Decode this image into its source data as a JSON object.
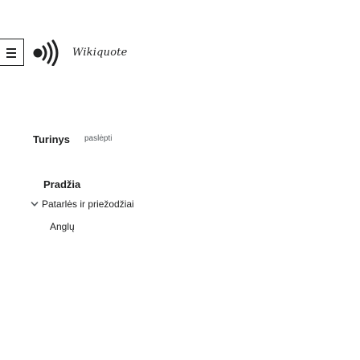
{
  "header": {
    "menu_icon": "hamburger-menu-icon",
    "logo_icon": "broadcast-sound-waves-icon",
    "wordmark": "Wikiquote"
  },
  "toolbar": {
    "heading": "Turinys",
    "hide_label": "paslėpti"
  },
  "content": {
    "section_title": "Pradžia",
    "collapsible_label": "Patarlės ir priežodžiai",
    "collapsible_icon": "chevron-down-icon",
    "language_link": "Anglų"
  },
  "colors": {
    "text": "#202122",
    "muted": "#54595d",
    "border": "#202122",
    "background": "#ffffff"
  }
}
